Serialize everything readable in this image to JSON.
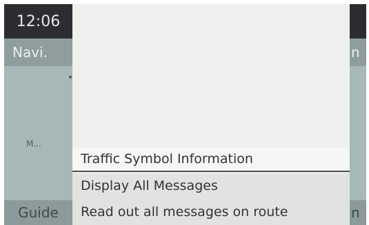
{
  "status": {
    "clock": "12:06"
  },
  "left_panel": {
    "tab_label": "Navi.",
    "map_label": "M...",
    "bottom_label": "Guide"
  },
  "right_panel": {
    "tab_label": "n",
    "bottom_label": "n"
  },
  "menu": {
    "items": [
      {
        "label": "Traffic Symbol Information",
        "selected": true
      },
      {
        "label": "Display All Messages",
        "selected": false
      },
      {
        "label": "Read out all messages on route",
        "selected": false
      }
    ]
  }
}
